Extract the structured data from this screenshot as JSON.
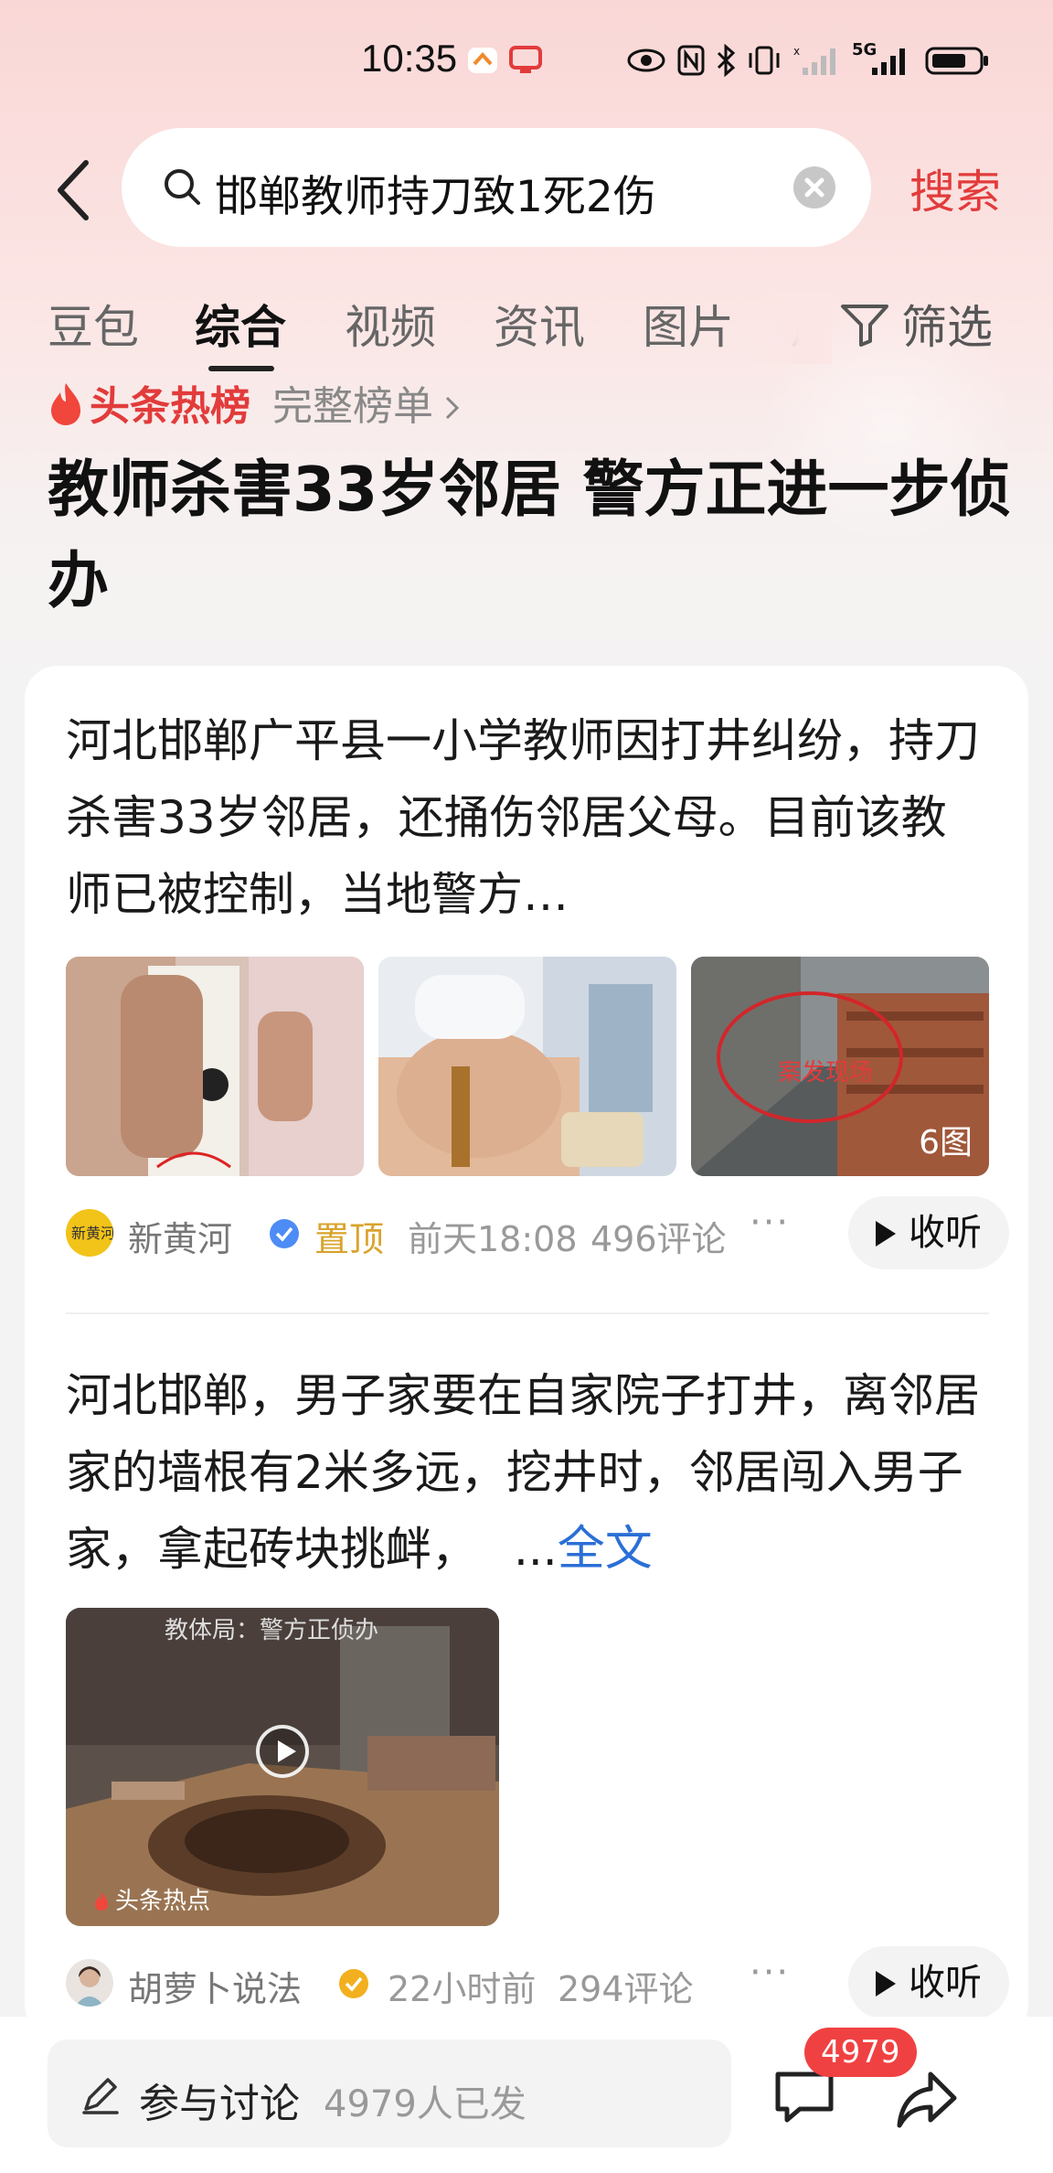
{
  "status_bar": {
    "time": "10:35",
    "network": "5G"
  },
  "search": {
    "query": "邯郸教师持刀致1死2伤",
    "submit_label": "搜索"
  },
  "tabs": [
    {
      "label": "豆包",
      "active": false
    },
    {
      "label": "综合",
      "active": true
    },
    {
      "label": "视频",
      "active": false
    },
    {
      "label": "资讯",
      "active": false
    },
    {
      "label": "图片",
      "active": false
    },
    {
      "label": "用",
      "active": false
    }
  ],
  "filter_label": "筛选",
  "hot_list": {
    "label": "头条热榜",
    "full_list_label": "完整榜单",
    "headline": "教师杀害33岁邻居 警方正进一步侦办"
  },
  "articles": [
    {
      "text": "河北邯郸广平县一小学教师因打井纠纷，持刀杀害33岁邻居，还捅伤邻居父母。目前该教师已被控制，当地警方…",
      "image_count_label": "6图",
      "source": "新黄河",
      "pinned_label": "置顶",
      "time": "前天18:08",
      "comments": "496评论",
      "listen_label": "收听",
      "images": [
        {
          "overlay_text": ""
        },
        {
          "overlay_text": ""
        },
        {
          "overlay_text": "案发现场"
        }
      ]
    },
    {
      "text": "河北邯郸，男子家要在自家院子打井，离邻居家的墙根有2米多远，挖井时，邻居闯入男子家，拿起砖块挑衅，",
      "ellipsis": "...",
      "full_text_label": "全文",
      "video_caption": "教体局：警方正侦办",
      "video_badge": "头条热点",
      "source": "胡萝卜说法",
      "time": "22小时前",
      "comments": "294评论",
      "listen_label": "收听"
    }
  ],
  "bottom_bar": {
    "input_label": "参与讨论",
    "participants": "4979人已发",
    "comment_badge": "4979"
  },
  "colors": {
    "accent_red": "#e23b3b",
    "link_blue": "#2b6fd6",
    "pinned_gold": "#d9a32b"
  }
}
